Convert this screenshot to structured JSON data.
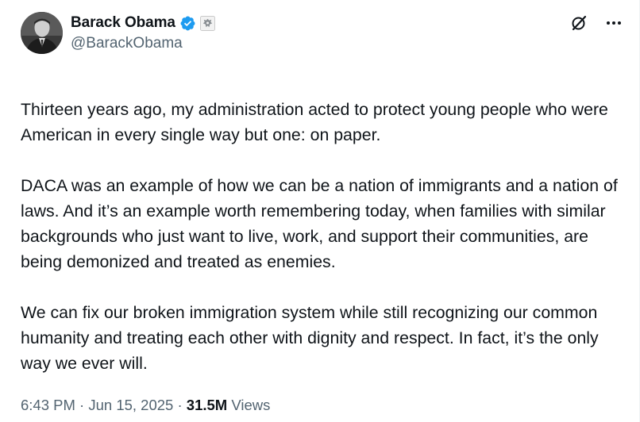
{
  "author": {
    "name": "Barack Obama",
    "handle": "@BarackObama",
    "verified_icon": "verified-badge-icon",
    "affiliation_icon": "government-seal-icon",
    "avatar_icon": "profile-avatar"
  },
  "actions": {
    "grok_icon": "grok-icon",
    "more_icon": "more-options-icon"
  },
  "tweet": {
    "paragraphs": [
      "Thirteen years ago, my administration acted to protect young people who were American in every single way but one: on paper.",
      "DACA was an example of how we can be a nation of immigrants and a nation of laws. And it’s an example worth remembering today, when families with similar backgrounds who just want to live, work, and support their communities, are being demonized and treated as enemies.",
      "We can fix our broken immigration system while still recognizing our common humanity and treating each other with dignity and respect. In fact, it’s the only way we ever will."
    ]
  },
  "meta": {
    "time": "6:43 PM",
    "separator": "·",
    "date": "Jun 15, 2025",
    "views_count": "31.5M",
    "views_label": "Views"
  },
  "colors": {
    "text": "#0f1419",
    "secondary": "#536471",
    "verified": "#1d9bf0"
  }
}
